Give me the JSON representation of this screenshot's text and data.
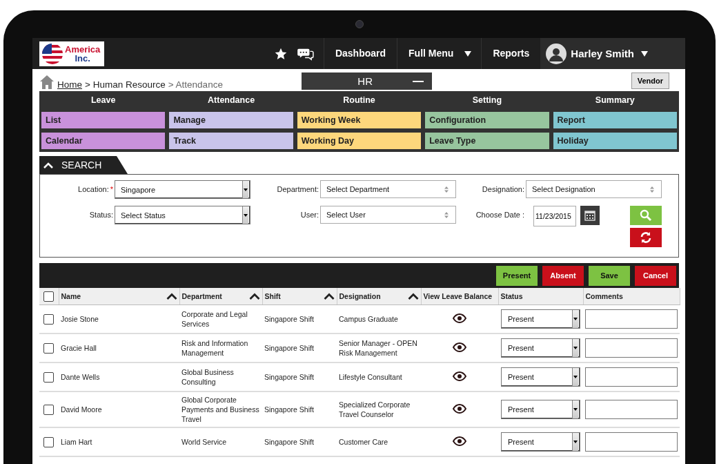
{
  "topbar": {
    "logo": {
      "line1": "America",
      "line2": "Inc."
    },
    "nav": [
      {
        "label": "Dashboard",
        "kind": "link"
      },
      {
        "label": "Full Menu",
        "kind": "dropdown"
      },
      {
        "label": "Reports",
        "kind": "link"
      }
    ],
    "user": {
      "name": "Harley Smith"
    }
  },
  "breadcrumb": [
    {
      "label": "Home",
      "kind": "link"
    },
    {
      "label": "> Human Resource",
      "kind": "text"
    },
    {
      "label": "> Attendance",
      "kind": "current"
    }
  ],
  "module_tab": {
    "label": "HR",
    "expanded": true
  },
  "vendor_button": "Vendor",
  "menu": [
    {
      "heading": "Leave",
      "color": "#c991db",
      "items": [
        "List",
        "Calendar"
      ]
    },
    {
      "heading": "Attendance",
      "color": "#c9c4eb",
      "items": [
        "Manage",
        "Track"
      ]
    },
    {
      "heading": "Routine",
      "color": "#fdd77c",
      "items": [
        "Working Week",
        "Working Day"
      ]
    },
    {
      "heading": "Setting",
      "color": "#97c59e",
      "items": [
        "Configuration",
        "Leave Type"
      ]
    },
    {
      "heading": "Summary",
      "color": "#80c6d0",
      "items": [
        "Report",
        "Holiday"
      ]
    }
  ],
  "search": {
    "title": "SEARCH",
    "expanded": true,
    "fields": [
      {
        "label": "Location:",
        "required_mark": "*",
        "value": "Singapore",
        "kind": "dropdown"
      },
      {
        "label": "Department:",
        "value": "Select Department",
        "kind": "spinner"
      },
      {
        "label": "Designation:",
        "value": "Select Designation",
        "kind": "spinner"
      },
      {
        "label": "Status:",
        "value": "Select Status",
        "kind": "dropdown"
      },
      {
        "label": "User:",
        "value": "Select User",
        "kind": "spinner"
      },
      {
        "label": "Choose Date :",
        "value": "11/23/2015",
        "kind": "date"
      }
    ]
  },
  "actions": [
    {
      "label": "Present",
      "kind": "positive"
    },
    {
      "label": "Absent",
      "kind": "negative"
    },
    {
      "label": "Save",
      "kind": "positive"
    },
    {
      "label": "Cancel",
      "kind": "negative"
    }
  ],
  "table": {
    "select_all": {
      "checked": false
    },
    "columns": [
      {
        "label": "Name",
        "sortable": true
      },
      {
        "label": "Department",
        "sortable": true
      },
      {
        "label": "Shift",
        "sortable": true
      },
      {
        "label": "Designation",
        "sortable": true
      },
      {
        "label": "View Leave Balance",
        "sortable": false
      },
      {
        "label": "Status",
        "sortable": false
      },
      {
        "label": "Comments",
        "sortable": false
      }
    ],
    "rows": [
      {
        "checked": false,
        "name": "Josie Stone",
        "department": "Corporate and Legal Services",
        "shift": "Singapore Shift",
        "designation": "Campus Graduate",
        "status": "Present"
      },
      {
        "checked": false,
        "name": "Gracie Hall",
        "department": "Risk and Information Management",
        "shift": "Singapore Shift",
        "designation": "Senior Manager - OPEN Risk Management",
        "status": "Present"
      },
      {
        "checked": false,
        "name": "Dante Wells",
        "department": "Global Business Consulting",
        "shift": "Singapore Shift",
        "designation": "Lifestyle Consultant",
        "status": "Present"
      },
      {
        "checked": false,
        "name": "David Moore",
        "department": "Global Corporate Payments and Business Travel",
        "shift": "Singapore Shift",
        "designation": "Specialized Corporate Travel Counselor",
        "status": "Present"
      },
      {
        "checked": false,
        "name": "Liam Hart",
        "department": "World Service",
        "shift": "Singapore Shift",
        "designation": "Customer Care",
        "status": "Present"
      }
    ]
  }
}
